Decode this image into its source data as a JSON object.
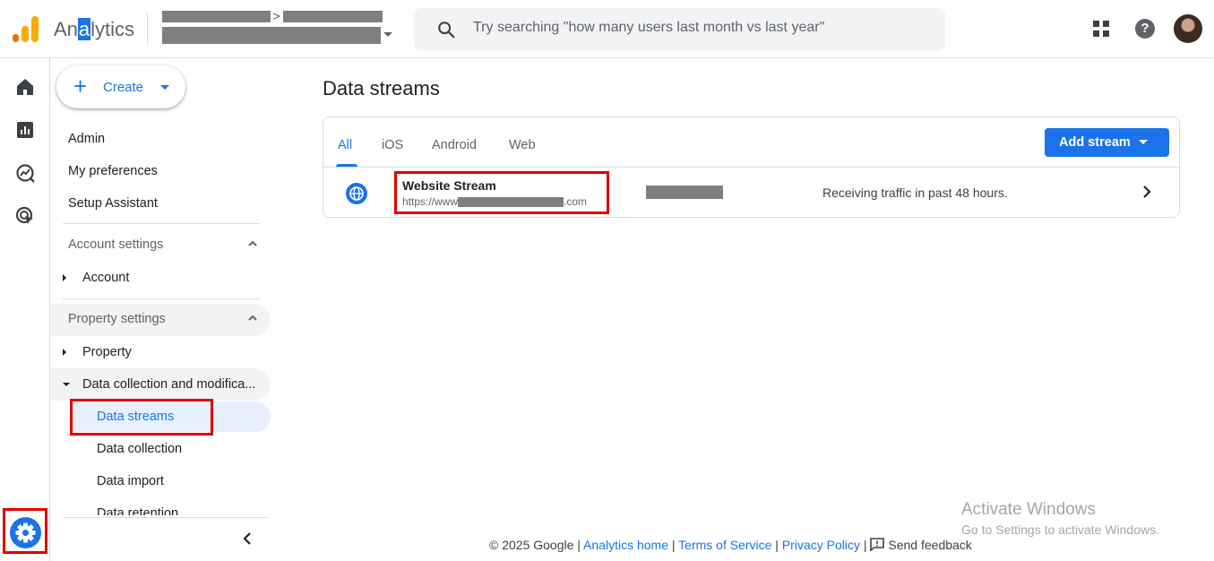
{
  "header": {
    "app_name": "Analytics",
    "search_placeholder": "Try searching \"how many users last month vs last year\"",
    "breadcrumb_separator": ">"
  },
  "icons": {
    "rail": [
      "home-icon",
      "reports-icon",
      "explore-icon",
      "advertising-icon"
    ],
    "settings": "settings-gear-icon",
    "apps": "apps-grid-icon",
    "help": "help-icon"
  },
  "sidenav": {
    "create_label": "Create",
    "top_items": [
      "Admin",
      "My preferences",
      "Setup Assistant"
    ],
    "account_settings": {
      "label": "Account settings",
      "account": "Account"
    },
    "property_settings": {
      "label": "Property settings",
      "property": "Property",
      "data_collection_group": "Data collection and modifica...",
      "sub_items": [
        "Data streams",
        "Data collection",
        "Data import",
        "Data retention"
      ]
    }
  },
  "main": {
    "page_title": "Data streams",
    "tabs": [
      "All",
      "iOS",
      "Android",
      "Web"
    ],
    "active_tab": "All",
    "add_stream_label": "Add stream",
    "stream": {
      "name": "Website Stream",
      "url_prefix": "https://www",
      "url_suffix": ".com",
      "status": "Receiving traffic in past 48 hours."
    }
  },
  "footer": {
    "copyright": "© 2025 Google",
    "links": [
      "Analytics home",
      "Terms of Service",
      "Privacy Policy"
    ],
    "separator": "|",
    "feedback": "Send feedback"
  },
  "watermark": {
    "title": "Activate Windows",
    "subtitle": "Go to Settings to activate Windows."
  },
  "colors": {
    "accent": "#1a73e8",
    "highlight_box": "#e00000",
    "redaction": "#7f7f7f"
  }
}
